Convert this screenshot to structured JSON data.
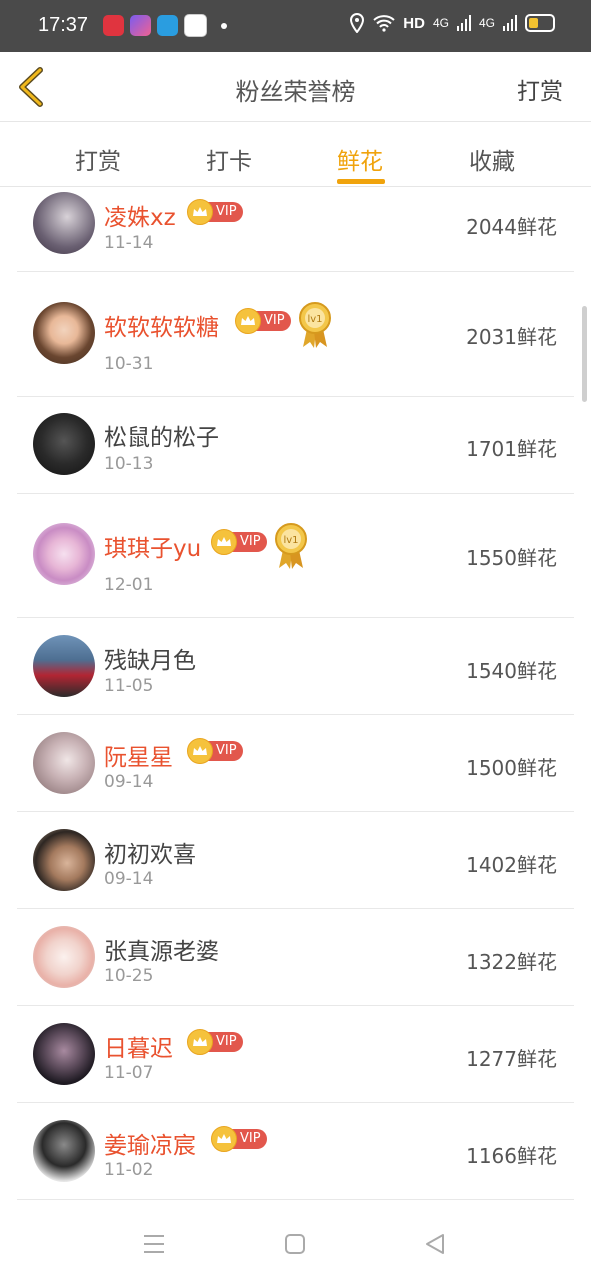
{
  "status_bar": {
    "time": "17:37",
    "hd": "HD",
    "net1": "4G",
    "net2": "4G",
    "app_icons": [
      "heart-app-icon",
      "purple-app-icon",
      "blue-app-icon",
      "video-app-icon"
    ]
  },
  "header": {
    "title": "粉丝荣誉榜",
    "right_action": "打赏"
  },
  "tabs": [
    {
      "label": "打赏",
      "active": false
    },
    {
      "label": "打卡",
      "active": false
    },
    {
      "label": "鲜花",
      "active": true
    },
    {
      "label": "收藏",
      "active": false
    }
  ],
  "vip_label": "VIP",
  "medal_label": "lv1",
  "list": [
    {
      "name": "凌姝xz",
      "date": "11-14",
      "value": "2044鲜花",
      "vip": true,
      "medal": false
    },
    {
      "name": "软软软软糖",
      "date": "10-31",
      "value": "2031鲜花",
      "vip": true,
      "medal": true
    },
    {
      "name": "松鼠的松子",
      "date": "10-13",
      "value": "1701鲜花",
      "vip": false,
      "medal": false
    },
    {
      "name": "琪琪子yu",
      "date": "12-01",
      "value": "1550鲜花",
      "vip": true,
      "medal": true
    },
    {
      "name": "残缺月色",
      "date": "11-05",
      "value": "1540鲜花",
      "vip": false,
      "medal": false
    },
    {
      "name": "阮星星",
      "date": "09-14",
      "value": "1500鲜花",
      "vip": true,
      "medal": false
    },
    {
      "name": "初初欢喜",
      "date": "09-14",
      "value": "1402鲜花",
      "vip": false,
      "medal": false
    },
    {
      "name": "张真源老婆",
      "date": "10-25",
      "value": "1322鲜花",
      "vip": false,
      "medal": false
    },
    {
      "name": "日暮迟",
      "date": "11-07",
      "value": "1277鲜花",
      "vip": true,
      "medal": false
    },
    {
      "name": "姜瑜凉宸",
      "date": "11-02",
      "value": "1166鲜花",
      "vip": true,
      "medal": false
    }
  ],
  "colors": {
    "accent": "#f0a30c",
    "vip_name": "#e9522f",
    "vip_tag": "#e2574c",
    "crown": "#f5c23c"
  }
}
